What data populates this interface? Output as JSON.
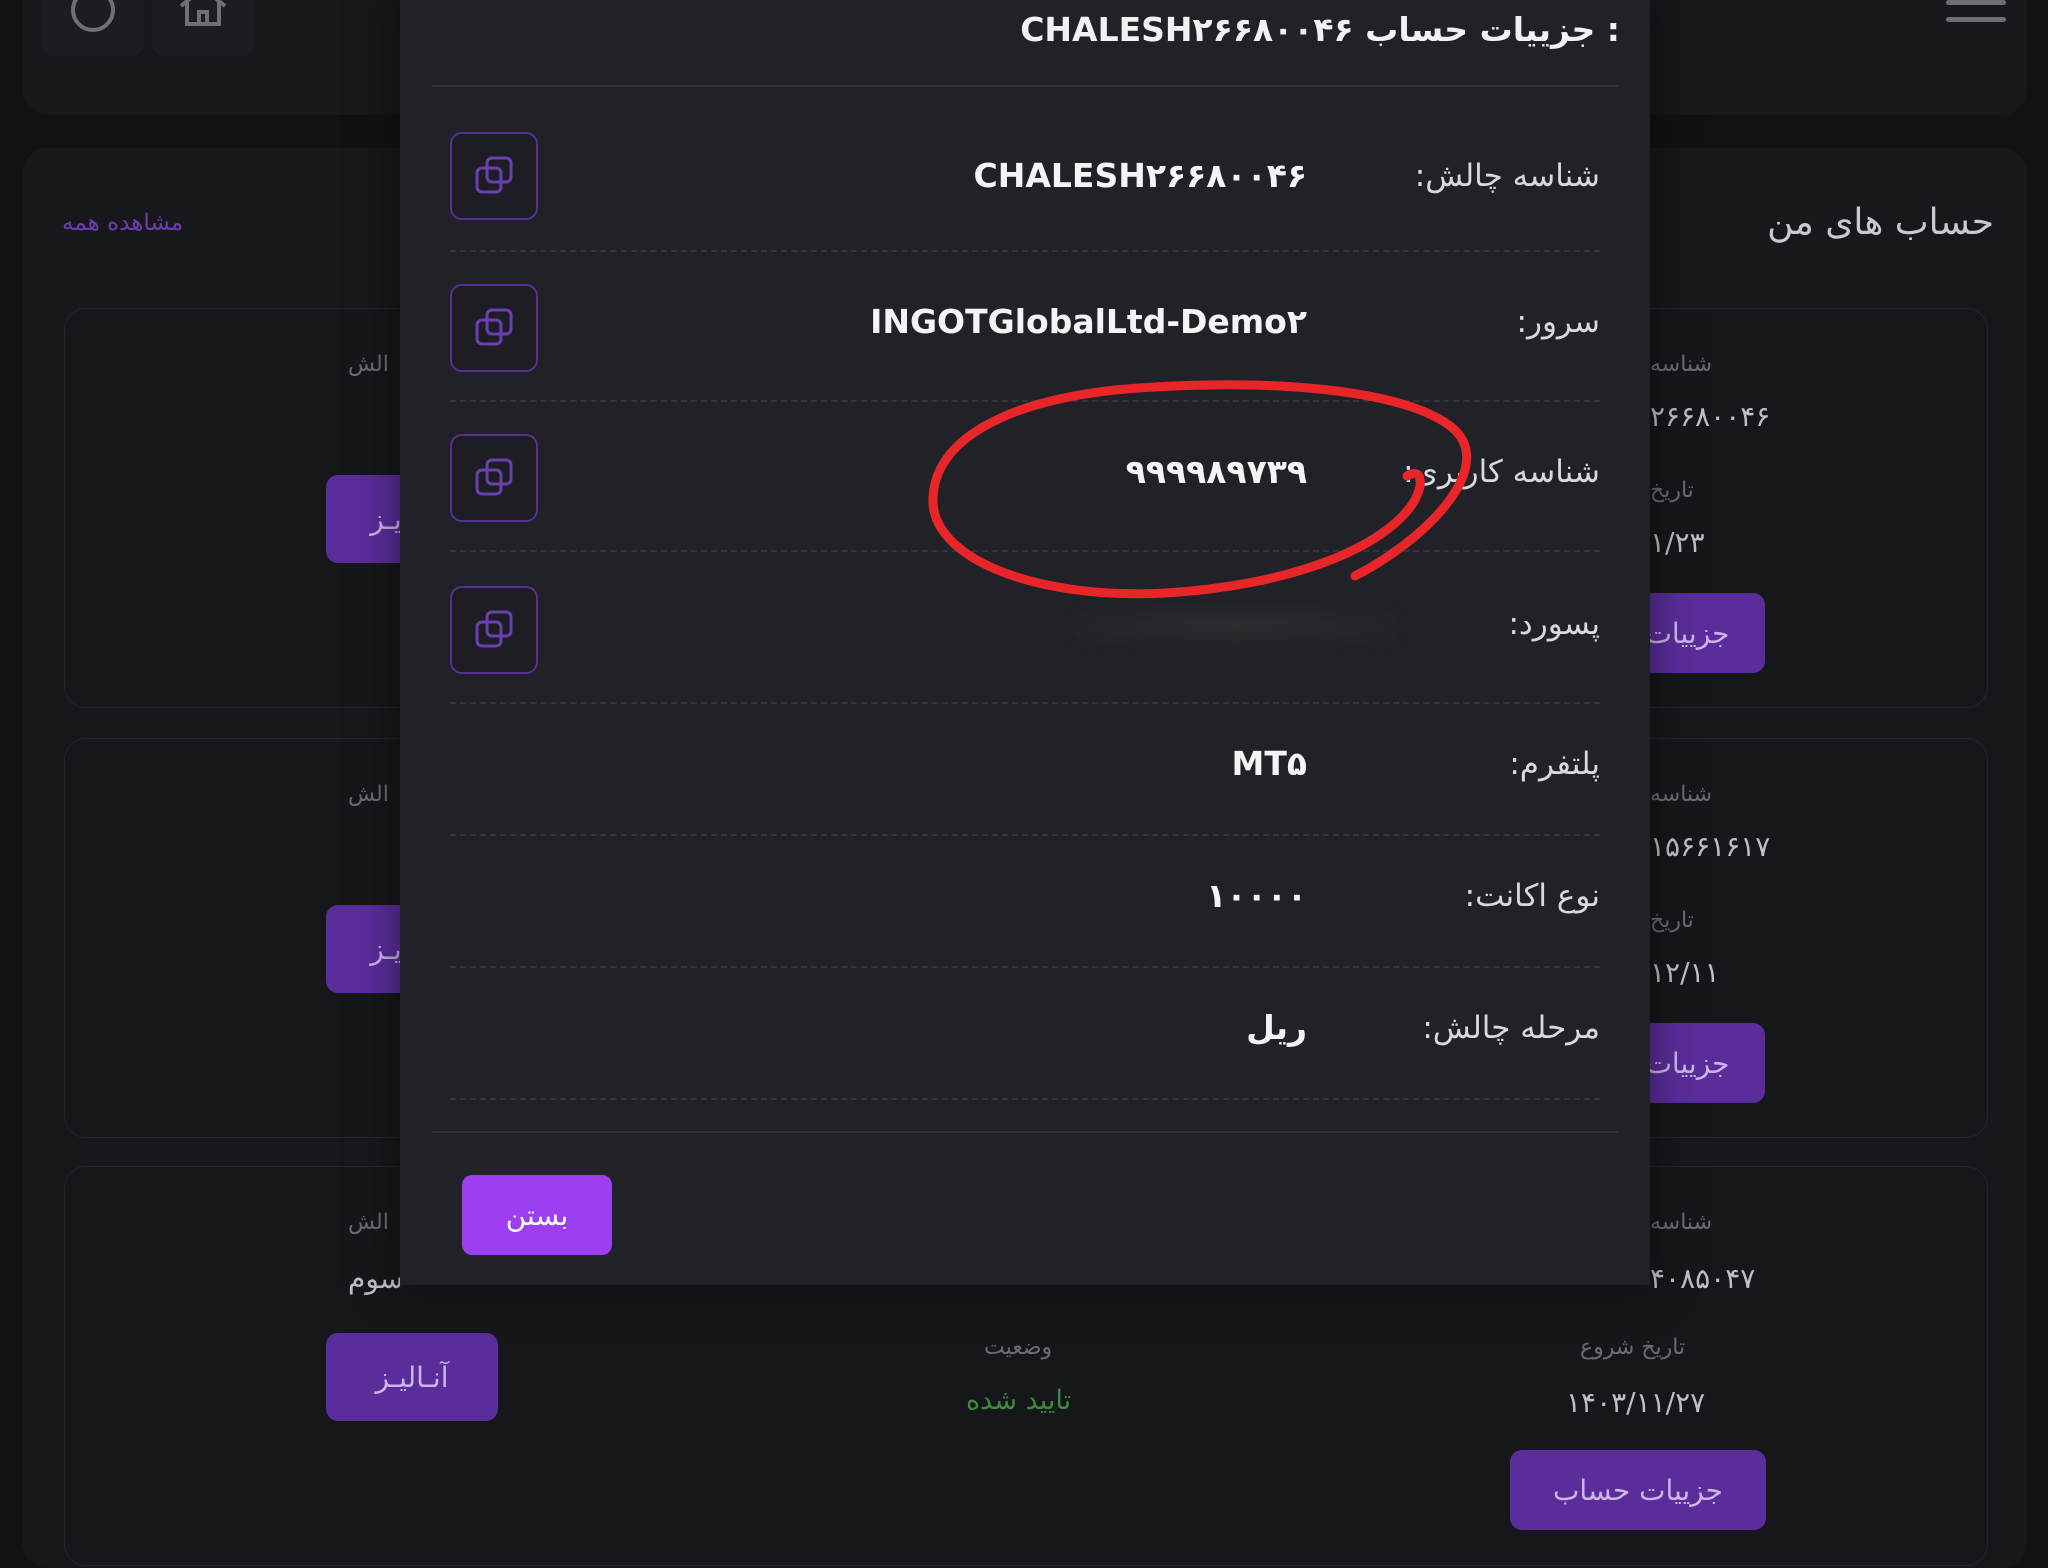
{
  "background": {
    "panel_title": "حساب های من",
    "view_all": "مشاهده همه",
    "cards": [
      {
        "challenge_label_partial": "الش",
        "challenge_id_partial": "۲۶۶۸۰۰۴۶",
        "challenge_id_label_partial": "شناسه",
        "date_label_partial": "تاریخ",
        "date_partial": "۱/۲۳",
        "analyze_partial": "یـز",
        "details_partial": "جزییات"
      },
      {
        "challenge_label_partial": "الش",
        "challenge_id_partial": "۱۵۶۶۱۶۱۷",
        "challenge_id_label_partial": "شناسه",
        "date_label_partial": "تاریخ",
        "date_partial": "۱۲/۱۱",
        "analyze_partial": "یـز",
        "details_partial": "جزییات"
      },
      {
        "challenge_label_partial": "الش",
        "phase_partial": "سوم",
        "challenge_id_label_partial": "شناسه",
        "challenge_id_partial": "۴۰۸۵۰۴۷",
        "analyze": "آنـالیـز",
        "status_label": "وضعیت",
        "status": "تایید شده",
        "start_date_label": "تاریخ شروع",
        "start_date": "۱۴۰۳/۱۱/۲۷",
        "details": "جزییات حساب"
      }
    ]
  },
  "modal": {
    "title_label": "جزییات حساب :",
    "title_id": "CHALESH۲۶۶۸۰۰۴۶",
    "rows": [
      {
        "label": "شناسه چالش:",
        "value": "CHALESH۲۶۶۸۰۰۴۶"
      },
      {
        "label": "سرور:",
        "value": "INGOTGlobalLtd-Demo۲"
      },
      {
        "label": "شناسه کاربری:",
        "value": "۹۹۹۹۸۹۷۳۹"
      },
      {
        "label": "پسورد:",
        "value": ""
      },
      {
        "label": "پلتفرم:",
        "value": "MT۵"
      },
      {
        "label": "نوع اکانت:",
        "value": "۱۰۰۰۰"
      },
      {
        "label": "مرحله چالش:",
        "value": "ریل"
      }
    ],
    "close_label": "بستن"
  },
  "colors": {
    "accent": "#9b3ff0",
    "annotation": "#e8262a",
    "success": "#3c8a3a"
  }
}
